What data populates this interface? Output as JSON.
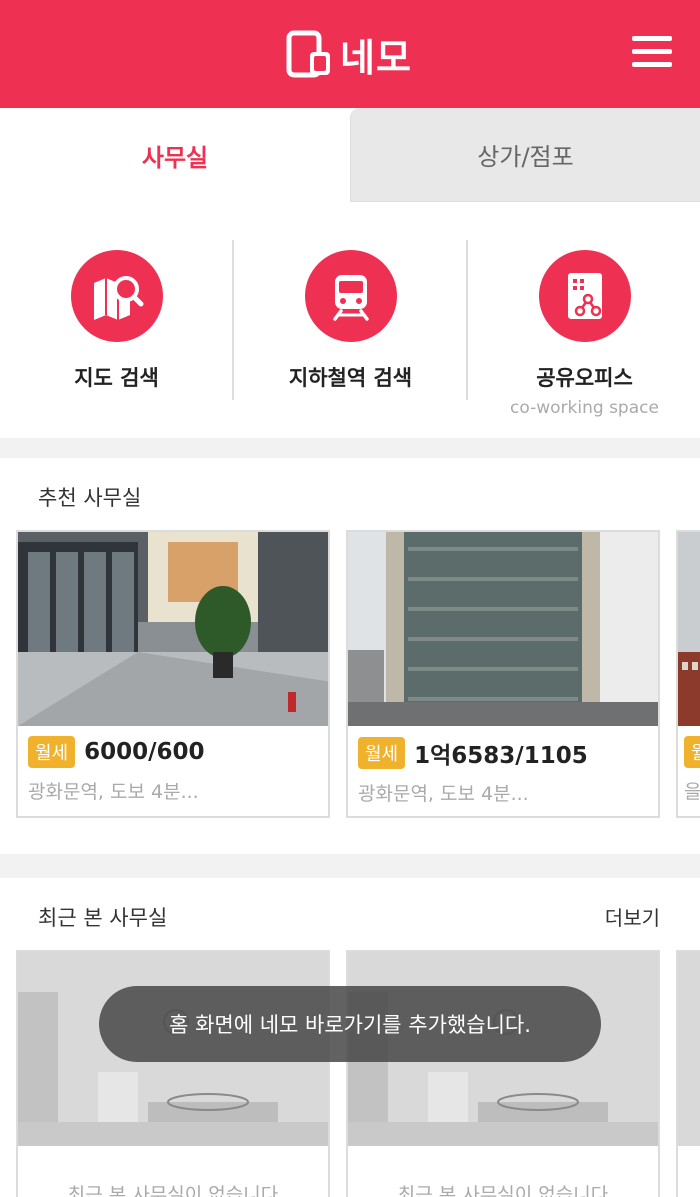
{
  "header": {
    "logo_text": "네모",
    "colors": {
      "brand": "#ee3152"
    }
  },
  "tabs": [
    {
      "label": "사무실",
      "active": true
    },
    {
      "label": "상가/점포",
      "active": false
    }
  ],
  "quick_menu": [
    {
      "label": "지도 검색",
      "icon": "map-search-icon"
    },
    {
      "label": "지하철역 검색",
      "icon": "subway-icon"
    },
    {
      "label": "공유오피스",
      "sublabel": "co-working space",
      "icon": "shared-office-icon"
    }
  ],
  "recommended": {
    "title": "추천 사무실",
    "items": [
      {
        "badge": "월세",
        "price": "6000/600",
        "location": "광화문역, 도보 4분..."
      },
      {
        "badge": "월세",
        "price": "1억6583/1105",
        "location": "광화문역, 도보 4분..."
      },
      {
        "badge": "월",
        "price": "",
        "location": "을"
      }
    ]
  },
  "recent": {
    "title": "최근 본 사무실",
    "more_label": "더보기",
    "items": [
      {
        "empty_text": "최근 본 사무실이 없습니다"
      },
      {
        "empty_text": "최근 본 사무실이 없습니다"
      }
    ]
  },
  "toast": {
    "message": "홈 화면에 네모 바로가기를 추가했습니다."
  }
}
